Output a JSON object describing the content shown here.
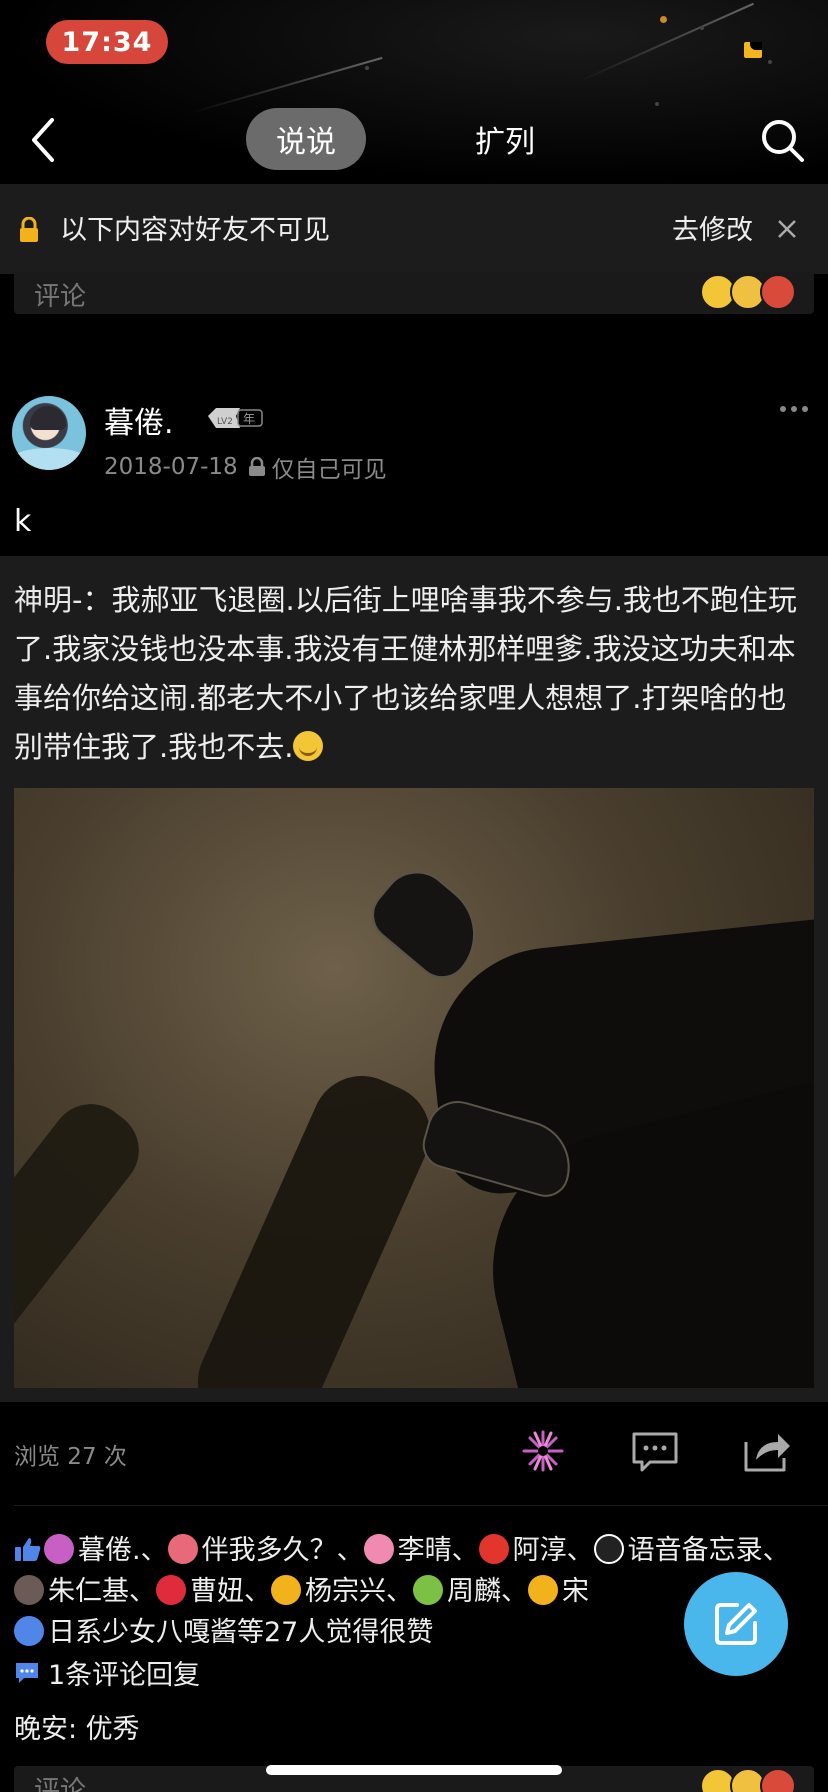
{
  "status_bar": {
    "time": "17:34"
  },
  "nav": {
    "active_tab": "说说",
    "other_tab": "扩列"
  },
  "notice": {
    "text": "以下内容对好友不可见",
    "action": "去修改"
  },
  "comment_placeholder": "评论",
  "post": {
    "username": "暮倦.",
    "level_badge": "LV2",
    "year_badge": "年",
    "date": "2018-07-18",
    "visibility": "仅自己可见",
    "text": "k"
  },
  "forward": {
    "author": "神明-",
    "separator": "：",
    "text": "我郝亚飞退圈.以后街上哩啥事我不参与.我也不跑住玩了.我家没钱也没本事.我没有王健林那样哩爹.我没这功夫和本事给你给这闹.都老大不小了也该给家哩人想想了.打架啥的也别带住我了.我也不去."
  },
  "stats": {
    "views": "浏览 27 次"
  },
  "likes": {
    "names": [
      "暮倦.",
      "伴我多久？",
      "李晴",
      "阿淳",
      "语音备忘录",
      "朱仁基",
      "曹妞",
      "杨宗兴",
      "周麟",
      "宋",
      "日系少女八嘎酱"
    ],
    "summary": "等27人觉得很赞",
    "badge_colors": [
      "#c85fc4",
      "#e86a7a",
      "#f08ab0",
      "#e2352c",
      "#222222",
      "#6b5a55",
      "#e02c3a",
      "#f2b21c",
      "#7cc046",
      "#f2b21c",
      "#4f86e8"
    ]
  },
  "comments": {
    "count_text": "1条评论回复",
    "reply": "晚安: 优秀"
  },
  "colors": {
    "time_pill": "#d6463a",
    "fab": "#4ab7ec",
    "tab_active_bg": "#6b6b6b"
  }
}
